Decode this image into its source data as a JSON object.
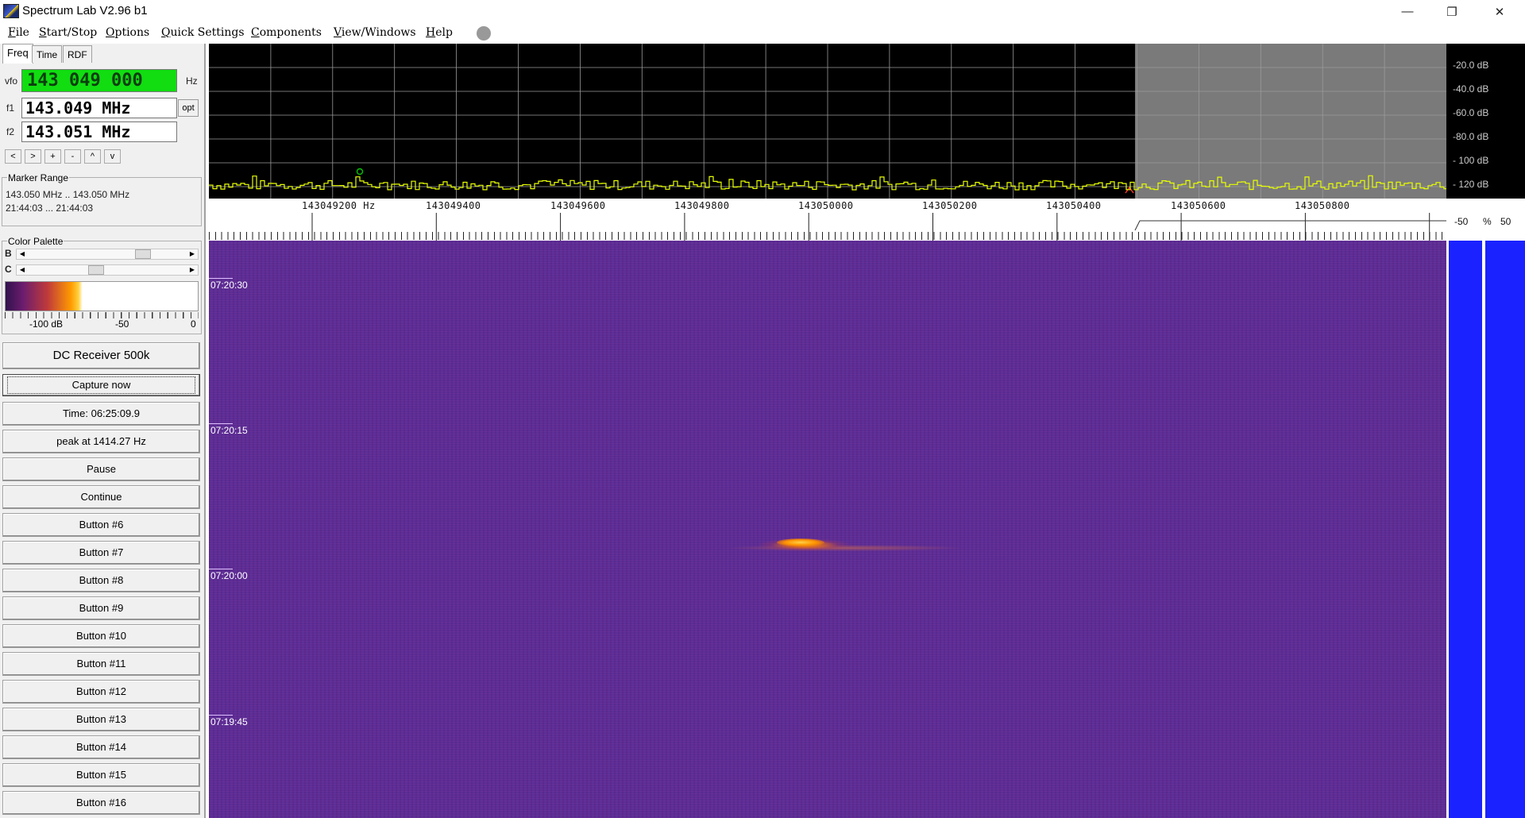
{
  "window": {
    "title": "Spectrum Lab V2.96 b1",
    "minimize": "—",
    "maximize": "❐",
    "close": "✕"
  },
  "menu": [
    "File",
    "Start/Stop",
    "Options",
    "Quick Settings",
    "Components",
    "View/Windows",
    "Help"
  ],
  "tabs": [
    "Freq",
    "Time",
    "RDF"
  ],
  "vfo": {
    "label": "vfo",
    "value": "143 049 000",
    "unit": "Hz"
  },
  "f1": {
    "label": "f1",
    "value": "143.049 MHz",
    "opt": "opt"
  },
  "f2": {
    "label": "f2",
    "value": "143.051 MHz"
  },
  "nav_buttons": [
    "<",
    ">",
    "+",
    "-",
    "^",
    "v"
  ],
  "marker_range": {
    "title": "Marker Range",
    "freq": "143.050 MHz .. 143.050 MHz",
    "time": "21:44:03 ... 21:44:03"
  },
  "color_palette": {
    "title": "Color Palette",
    "b_label": "B",
    "c_label": "C",
    "b_level": 0.75,
    "c_level": 0.42,
    "scale_labels": [
      "-100 dB",
      "-50",
      "0"
    ]
  },
  "buttons": {
    "dc_receiver": "DC Receiver 500k",
    "capture": "Capture now",
    "time": "Time:  06:25:09.9",
    "peak": "peak at 1414.27 Hz",
    "pause": "Pause",
    "continue": "Continue",
    "numbered": [
      "Button #6",
      "Button #7",
      "Button #8",
      "Button #9",
      "Button #10",
      "Button #11",
      "Button #12",
      "Button #13",
      "Button #14",
      "Button #15",
      "Button #16"
    ]
  },
  "spectrum": {
    "db_labels": [
      "-20.0 dB",
      "-40.0 dB",
      "-60.0 dB",
      "-80.0 dB",
      "- 100 dB",
      "- 120 dB"
    ],
    "trace_color": "#e8ff00",
    "grid_color": "#9a9a9a",
    "marker_color": "#00c000"
  },
  "freq_axis": {
    "labels": [
      "143049200  Hz",
      "143049400",
      "143049600",
      "143049800",
      "143050000",
      "143050200",
      "143050400",
      "143050600",
      "143050800"
    ],
    "right_labels": [
      "-50",
      "%",
      "50"
    ]
  },
  "waterfall": {
    "time_labels": [
      "07:20:30",
      "07:20:15",
      "07:20:00",
      "07:19:45"
    ],
    "background_color": "#5b2f96",
    "signal_color": "#ff9a00"
  }
}
